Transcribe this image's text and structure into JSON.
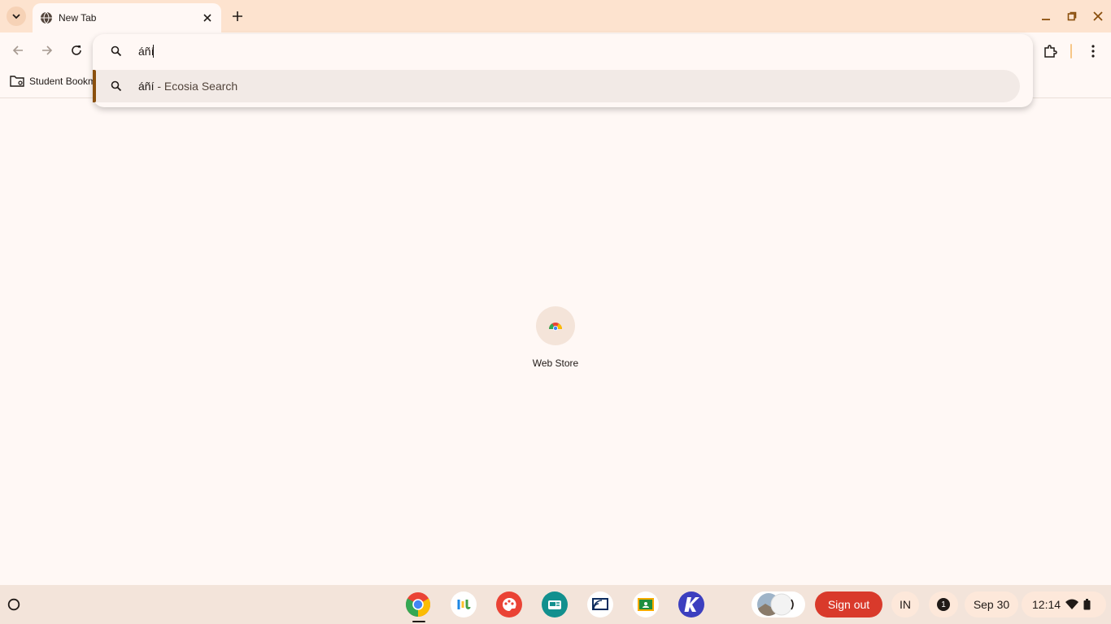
{
  "tab": {
    "title": "New Tab"
  },
  "bookmarks": {
    "items": [
      {
        "label": "Student Bookm"
      }
    ]
  },
  "omnibox": {
    "value": "áñí",
    "suggestion": {
      "query": "áñí",
      "separator": " - ",
      "engine": "Ecosia Search"
    }
  },
  "shortcuts": [
    {
      "label": "Web Store"
    }
  ],
  "shelf": {
    "apps": [
      "chrome-icon",
      "app-icon-2",
      "paint-icon",
      "app-icon-4",
      "screencast-icon",
      "classroom-icon",
      "k-app-icon"
    ],
    "signout_label": "Sign out",
    "ime_label": "IN",
    "notification_count": "1",
    "date": "Sep 30",
    "time": "12:14"
  },
  "colors": {
    "accent": "#8a4f0d",
    "signout": "#d93a2b",
    "tabstrip": "#fde3cf"
  }
}
